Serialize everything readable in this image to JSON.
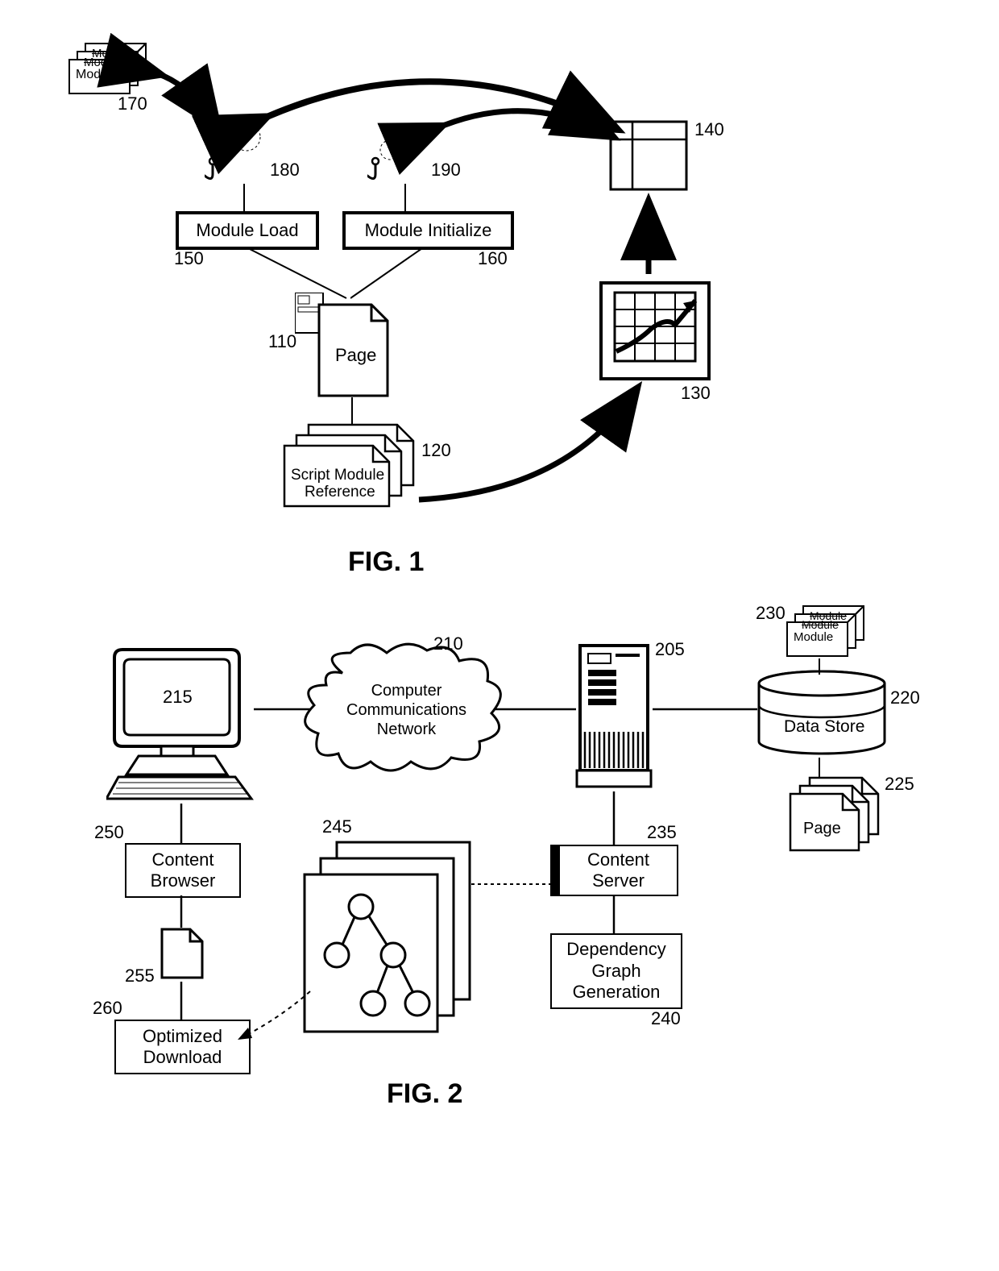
{
  "fig1": {
    "label": "FIG. 1",
    "modules_stack": {
      "l1": "Module",
      "l2": "Module",
      "l3": "Module",
      "ref": "170"
    },
    "hooks": {
      "load_ref": "180",
      "init_ref": "190"
    },
    "module_load": {
      "label": "Module Load",
      "ref": "150"
    },
    "module_init": {
      "label": "Module Initialize",
      "ref": "160"
    },
    "page": {
      "label": "Page",
      "ref": "110"
    },
    "script_ref": {
      "line1": "Script Module",
      "line2": "Reference",
      "ref": "120"
    },
    "chart_icon": {
      "ref": "130"
    },
    "table_icon": {
      "ref": "140"
    }
  },
  "fig2": {
    "label": "FIG. 2",
    "monitor_ref": "215",
    "cloud": {
      "line1": "Computer",
      "line2": "Communications",
      "line3": "Network",
      "ref": "210"
    },
    "server_ref": "205",
    "modules_stack": {
      "l1": "Module",
      "l2": "Module",
      "l3": "Module",
      "ref": "230"
    },
    "datastore": {
      "label": "Data Store",
      "ref": "220"
    },
    "page": {
      "label": "Page",
      "ref": "225"
    },
    "content_browser": {
      "line1": "Content",
      "line2": "Browser",
      "ref": "250"
    },
    "content_server": {
      "line1": "Content",
      "line2": "Server",
      "ref": "235"
    },
    "dep_graph": {
      "line1": "Dependency",
      "line2": "Graph",
      "line3": "Generation",
      "ref": "240"
    },
    "doc255_ref": "255",
    "tree_ref": "245",
    "optimized": {
      "line1": "Optimized",
      "line2": "Download",
      "ref": "260"
    }
  }
}
